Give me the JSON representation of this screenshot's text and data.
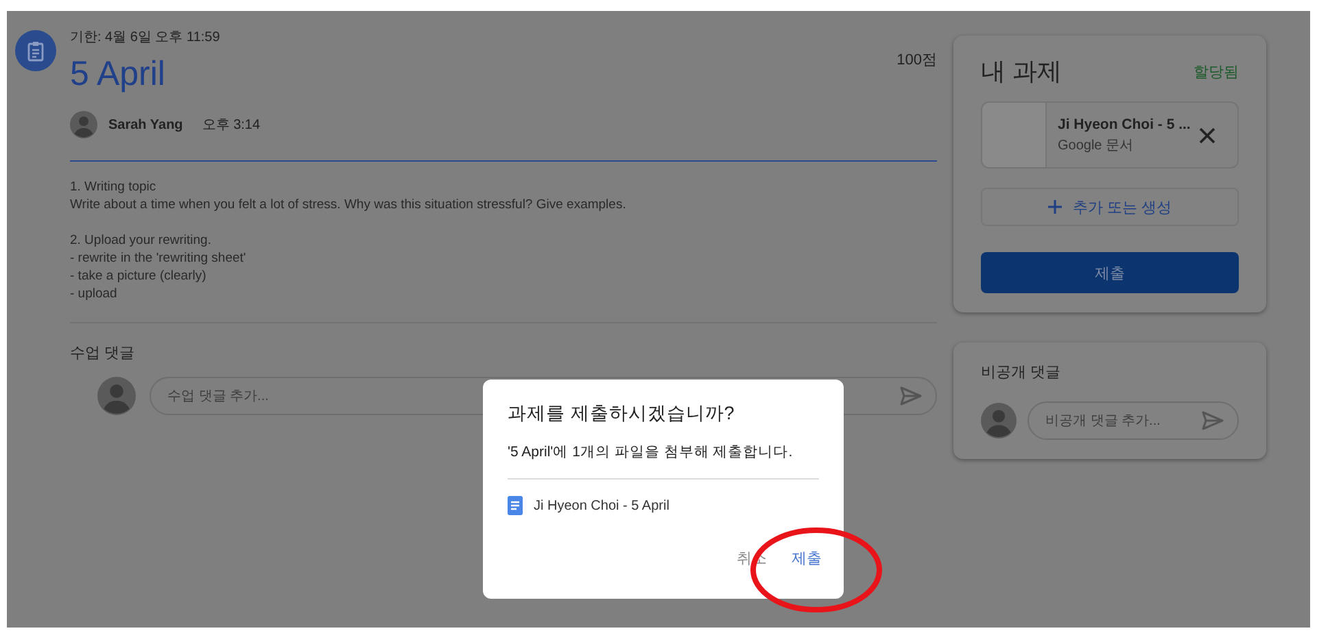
{
  "assignment": {
    "due": "기한: 4월 6일 오후 11:59",
    "title": "5 April",
    "points": "100점",
    "author": "Sarah Yang",
    "posted": "오후 3:14",
    "description": [
      [
        "1. Writing topic",
        "Write about a time when you felt a lot of stress. Why was this situation stressful? Give examples."
      ],
      [
        "2. Upload your rewriting.",
        "- rewrite in the 'rewriting sheet'",
        "- take a picture (clearly)",
        "- upload"
      ]
    ]
  },
  "class_comments": {
    "title": "수업 댓글",
    "placeholder": "수업 댓글 추가..."
  },
  "my_work": {
    "title": "내 과제",
    "status": "할당됨",
    "attachment": {
      "name": "Ji Hyeon Choi - 5 ...",
      "type": "Google 문서"
    },
    "add_button": "추가 또는 생성",
    "submit_button": "제출"
  },
  "private_comments": {
    "title": "비공개 댓글",
    "placeholder": "비공개 댓글 추가..."
  },
  "dialog": {
    "title": "과제를 제출하시겠습니까?",
    "message": "'5 April'에 1개의 파일을 첨부해 제출합니다.",
    "file": "Ji Hyeon Choi - 5 April",
    "buttons": [
      {
        "label": "취소",
        "kind": "cancel"
      },
      {
        "label": "제출",
        "kind": "confirm"
      }
    ]
  }
}
